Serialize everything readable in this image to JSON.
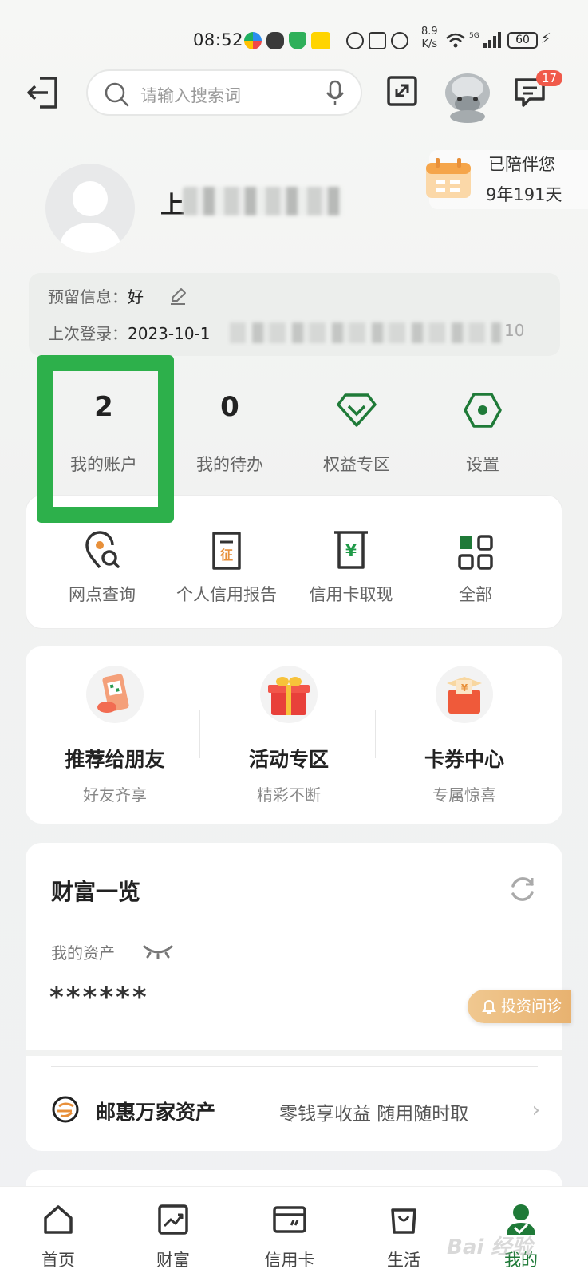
{
  "status_bar": {
    "time": "08:52",
    "net_speed_top": "8.9",
    "net_speed_bottom": "K/s",
    "battery": "60"
  },
  "top_bar": {
    "search_placeholder": "请输入搜索词",
    "message_badge": "17"
  },
  "profile": {
    "greeting": "上",
    "companion_line1": "已陪伴您",
    "companion_line2": "9年191天",
    "reserved_label": "预留信息：",
    "reserved_value": "好",
    "last_login_label": "上次登录：",
    "last_login_value": "2023-10-1",
    "last_login_tail": "10"
  },
  "stats": [
    {
      "value": "2",
      "label": "我的账户"
    },
    {
      "value": "0",
      "label": "我的待办"
    },
    {
      "label": "权益专区",
      "icon": "diamond-icon"
    },
    {
      "label": "设置",
      "icon": "settings-hexagon-icon"
    }
  ],
  "services": [
    {
      "label": "网点查询",
      "icon": "location-search-icon"
    },
    {
      "label": "个人信用报告",
      "icon": "credit-report-icon"
    },
    {
      "label": "信用卡取现",
      "icon": "atm-cash-icon"
    },
    {
      "label": "全部",
      "icon": "grid-all-icon"
    }
  ],
  "promos": [
    {
      "title": "推荐给朋友",
      "subtitle": "好友齐享"
    },
    {
      "title": "活动专区",
      "subtitle": "精彩不断"
    },
    {
      "title": "卡券中心",
      "subtitle": "专属惊喜"
    }
  ],
  "wealth": {
    "title": "财富一览",
    "asset_label": "我的资产",
    "asset_value": "******",
    "product_title": "邮惠万家资产",
    "product_desc": "零钱享收益 随用随时取",
    "invest_button": "投资问诊"
  },
  "bottom_nav": [
    {
      "label": "首页"
    },
    {
      "label": "财富"
    },
    {
      "label": "信用卡"
    },
    {
      "label": "生活"
    },
    {
      "label": "我的"
    }
  ],
  "watermark": "Bai 经验",
  "colors": {
    "brand_green": "#1f7a38",
    "highlight_green": "#2db04b",
    "badge_red": "#f05a4a"
  }
}
